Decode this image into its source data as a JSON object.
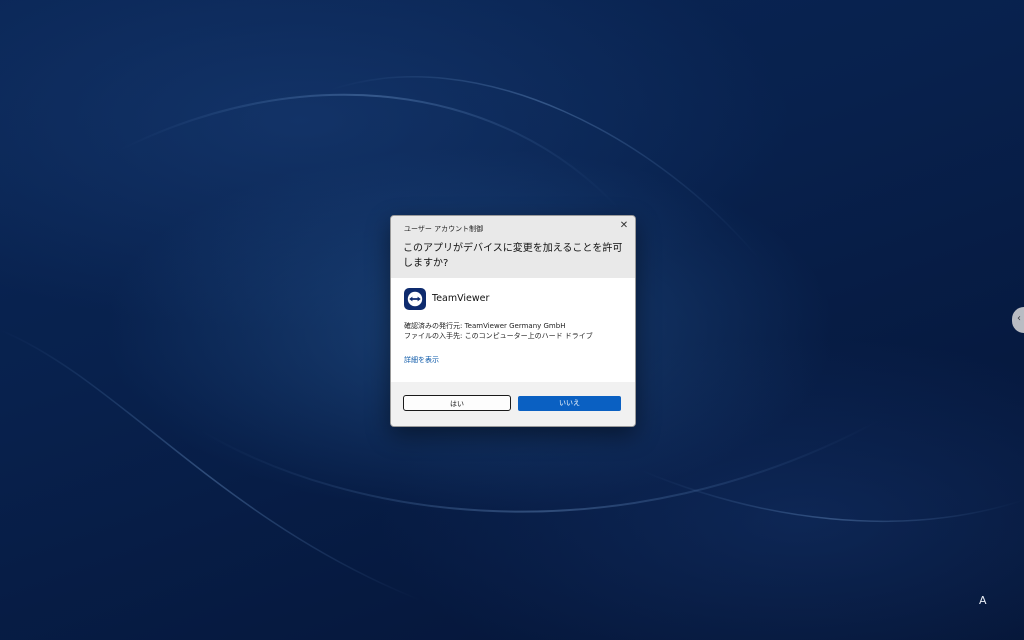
{
  "dialog": {
    "caption": "ユーザー アカウント制御",
    "close_glyph": "✕",
    "question": "このアプリがデバイスに変更を加えることを許可しますか?",
    "app": {
      "name": "TeamViewer",
      "icon": "teamviewer-logo-icon",
      "icon_color": "#0e2b6e"
    },
    "publisher_line": "確認済みの発行元: TeamViewer Germany GmbH",
    "origin_line": "ファイルの入手先: このコンピューター上のハード ドライブ",
    "details_link": "詳細を表示",
    "buttons": {
      "yes": "はい",
      "no": "いいえ"
    }
  },
  "desktop": {
    "edge_handle_icon": "chevron-left-icon",
    "ime_indicator": "A"
  },
  "colors": {
    "accent": "#0a60c2",
    "link": "#0b58a8",
    "background": "#08214d"
  }
}
